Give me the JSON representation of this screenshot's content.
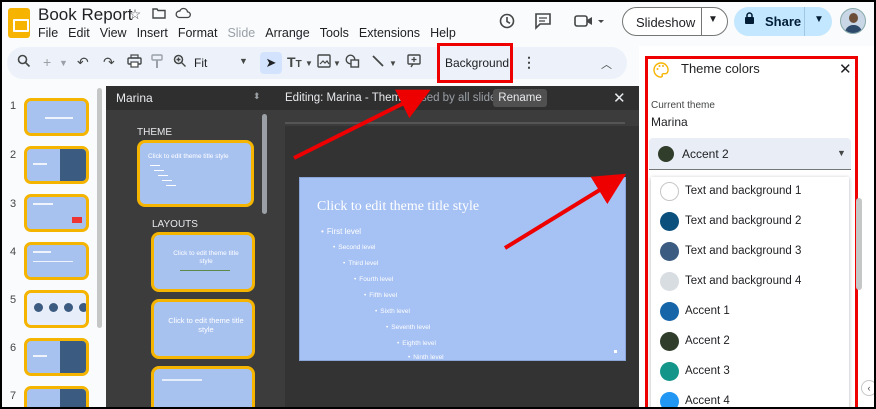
{
  "app": {
    "title": "Book Report",
    "menu": [
      "File",
      "Edit",
      "View",
      "Insert",
      "Format",
      "Slide",
      "Arrange",
      "Tools",
      "Extensions",
      "Help"
    ],
    "disabled_menu": "Slide"
  },
  "header": {
    "slideshow_label": "Slideshow",
    "share_label": "Share",
    "share_color": "#c2e7ff"
  },
  "toolbar": {
    "zoom": "Fit",
    "background_label": "Background"
  },
  "filmstrip": {
    "slide_numbers": [
      "1",
      "2",
      "3",
      "4",
      "5",
      "6",
      "7"
    ]
  },
  "master": {
    "header": "Marina",
    "theme_label": "THEME",
    "layouts_label": "LAYOUTS",
    "theme_thumb_text": "Click to edit theme title style",
    "layout1_text": "Click to edit theme title style",
    "layout2_text": "Click to edit theme title style"
  },
  "editor": {
    "header": "Editing: Marina - Theme",
    "header_hidden_tail": "(used by all slides)",
    "rename_label": "Rename",
    "slide_title": "Click to edit theme title style",
    "bullets": [
      "First level",
      "Second level",
      "Third level",
      "Fourth level",
      "Fifth level",
      "Sixth level",
      "Seventh level",
      "Eighth level",
      "Ninth level"
    ],
    "slide_color": "#a6c1f3"
  },
  "theme_panel": {
    "title": "Theme colors",
    "current_theme_label": "Current theme",
    "current_theme_value": "Marina",
    "selected": {
      "label": "Accent 2",
      "color": "#2f3d2a"
    },
    "options": [
      {
        "label": "Text and background 1",
        "color": "#ffffff"
      },
      {
        "label": "Text and background 2",
        "color": "#0b4f7c"
      },
      {
        "label": "Text and background 3",
        "color": "#3b5b80"
      },
      {
        "label": "Text and background 4",
        "color": "#d8dde2"
      },
      {
        "label": "Accent 1",
        "color": "#1565a8"
      },
      {
        "label": "Accent 2",
        "color": "#2f3d2a"
      },
      {
        "label": "Accent 3",
        "color": "#14958a"
      },
      {
        "label": "Accent 4",
        "color": "#2196f3"
      }
    ]
  },
  "colors": {
    "highlight_red": "#e00000",
    "accent_yellow": "#f4b400"
  }
}
